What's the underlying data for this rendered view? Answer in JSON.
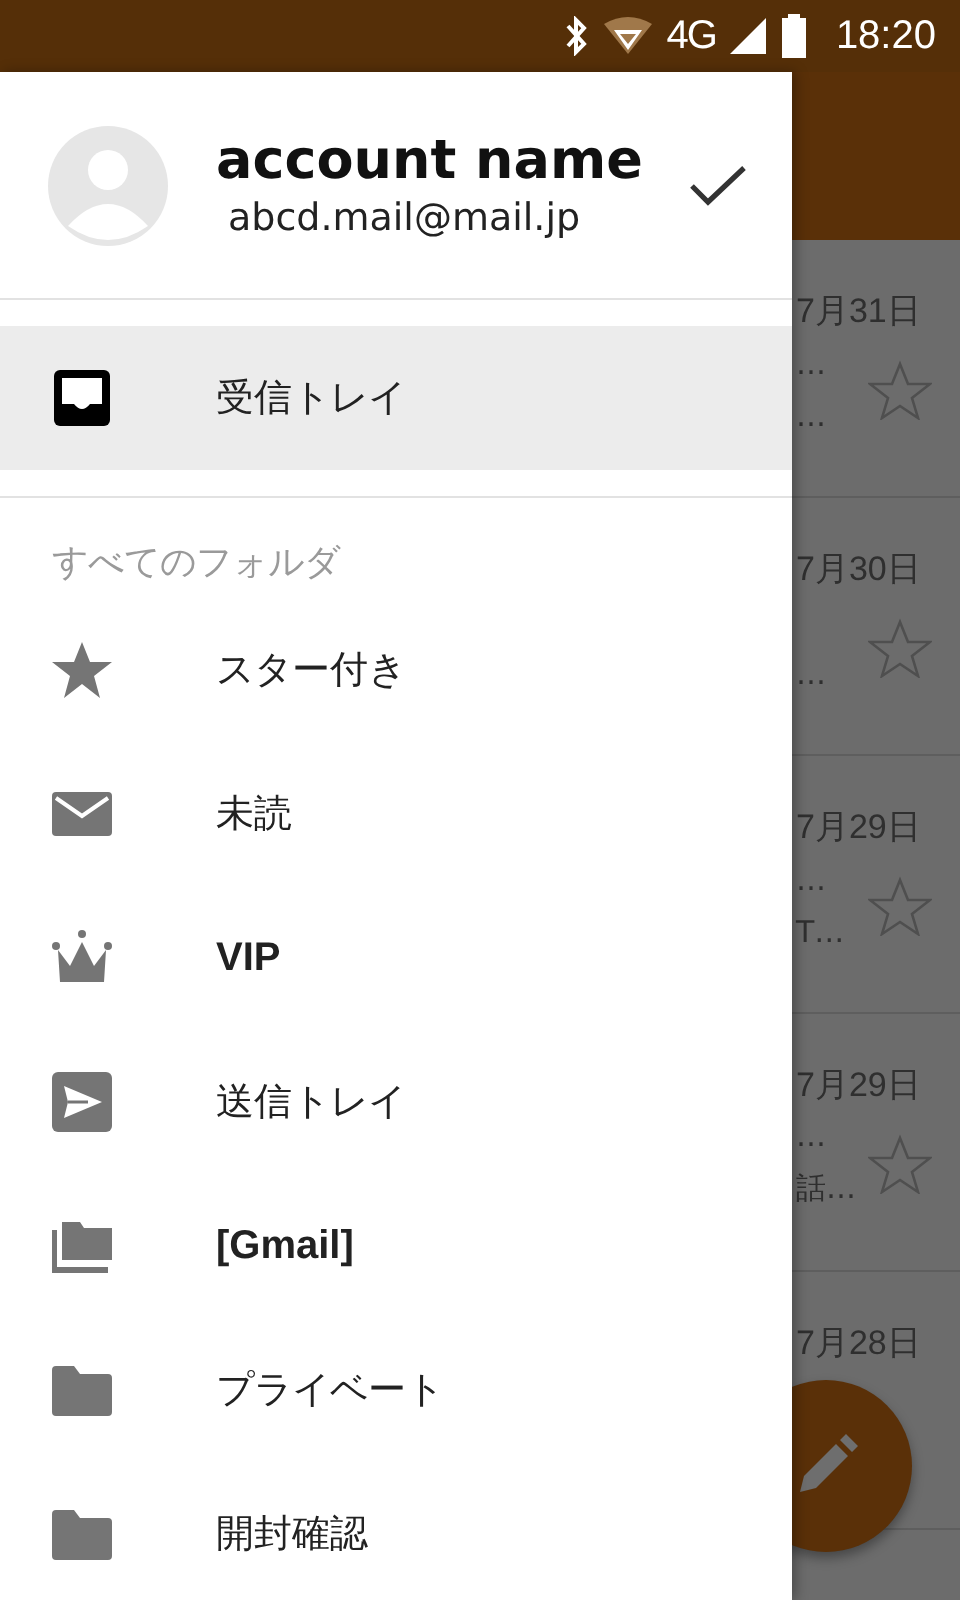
{
  "status_bar": {
    "network": "4G",
    "time": "18:20"
  },
  "message_list": [
    {
      "date": "7月31日",
      "line_1": "…",
      "line_2": "…",
      "starred": false
    },
    {
      "date": "7月30日",
      "line_2": "…",
      "starred": false
    },
    {
      "date": "7月29日",
      "line_1": "…",
      "line_2": "T…",
      "starred": false
    },
    {
      "date": "7月29日",
      "line_1": "…",
      "line_2": "話…",
      "starred": false
    },
    {
      "date": "7月28日"
    }
  ],
  "drawer": {
    "account": {
      "name": "account name",
      "email": "abcd.mail@mail.jp",
      "selected": true
    },
    "inbox": {
      "label": "受信トレイ",
      "selected": true
    },
    "section_title": "すべてのフォルダ",
    "folders": [
      {
        "kind": "starred",
        "label": "スター付き",
        "selected": false
      },
      {
        "kind": "unread",
        "label": "未読",
        "selected": false
      },
      {
        "kind": "vip",
        "label": "VIP",
        "selected": false
      },
      {
        "kind": "sent",
        "label": "送信トレイ",
        "selected": false
      },
      {
        "kind": "label-group",
        "label": "[Gmail]",
        "selected": false
      },
      {
        "kind": "folder",
        "label": "プライベート",
        "selected": false
      },
      {
        "kind": "folder",
        "label": "開封確認",
        "selected": false
      }
    ]
  }
}
